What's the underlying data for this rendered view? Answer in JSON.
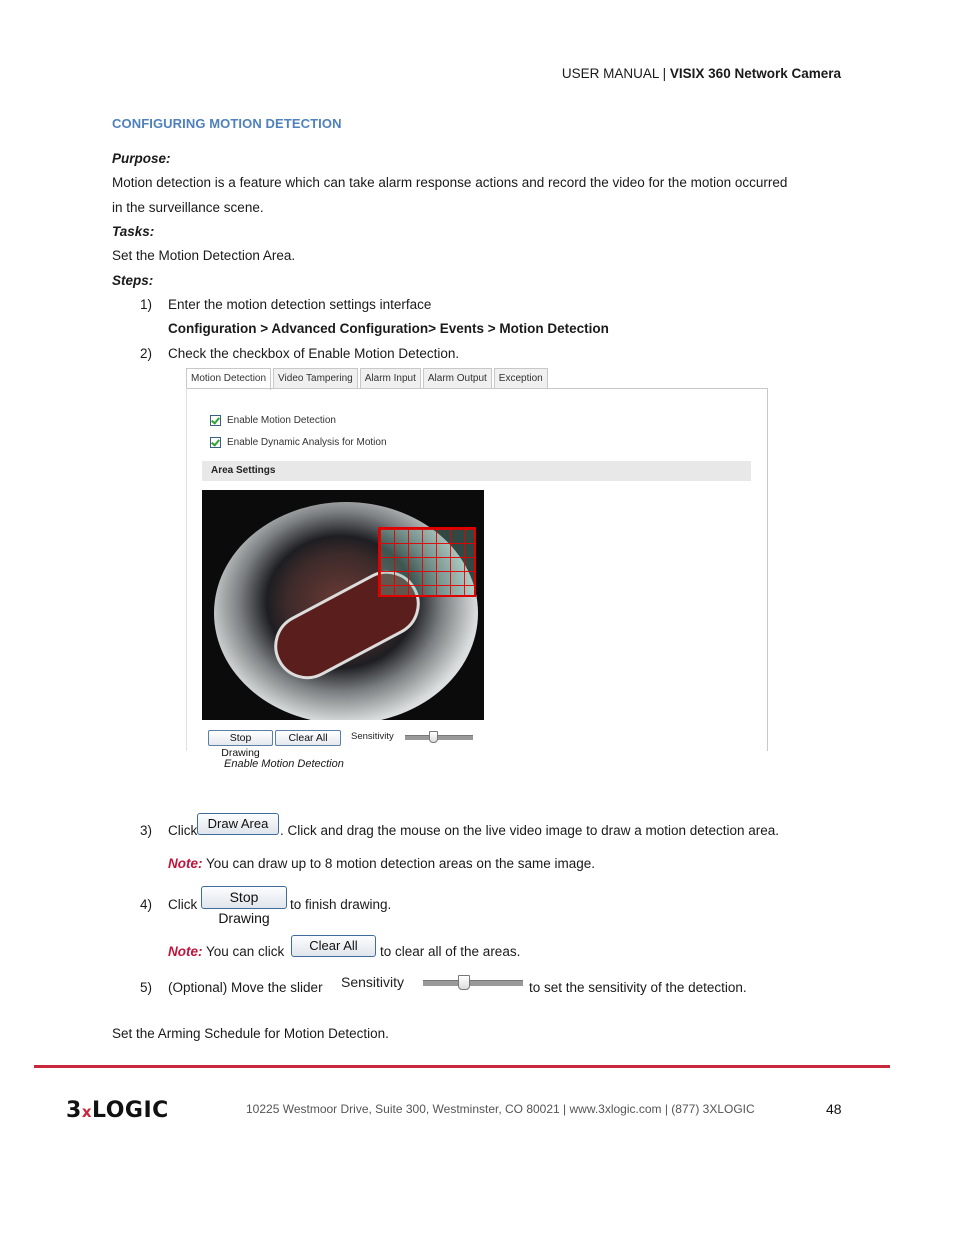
{
  "header": {
    "manual_label": "USER MANUAL",
    "separator": "|",
    "product": "VISIX 360 Network Camera"
  },
  "section_title": "CONFIGURING MOTION DETECTION",
  "purpose": {
    "label": "Purpose:",
    "line1": "Motion detection is a feature which can take alarm response actions and record the video for the motion occurred",
    "line2": "in the surveillance scene."
  },
  "tasks": {
    "label": "Tasks:",
    "text": "Set the Motion Detection Area."
  },
  "steps_label": "Steps:",
  "steps": [
    {
      "num": "1)",
      "text": "Enter the motion detection settings interface",
      "path": "Configuration > Advanced Configuration> Events > Motion Detection"
    },
    {
      "num": "2)",
      "text": "Check the checkbox of Enable Motion Detection."
    },
    {
      "num": "3)",
      "pre": "Click",
      "button": "Draw Area",
      "post": ". Click and drag the mouse on the live video image to draw a motion detection area.",
      "note_label": "Note:",
      "note_text": " You can draw up to 8 motion detection areas on the same image."
    },
    {
      "num": "4)",
      "pre": "Click",
      "button": "Stop Drawing",
      "post": "to finish drawing.",
      "note_label": "Note:",
      "note_pre": " You can click",
      "note_button": "Clear All",
      "note_post": "to clear all of the areas."
    },
    {
      "num": "5)",
      "pre": "(Optional) Move the slider",
      "slider_label": "Sensitivity",
      "slider_value_fraction": 0.4,
      "post": "to set the sensitivity of the detection."
    }
  ],
  "screenshot": {
    "tabs": [
      "Motion Detection",
      "Video Tampering",
      "Alarm Input",
      "Alarm Output",
      "Exception"
    ],
    "active_tab": "Motion Detection",
    "checkboxes": [
      {
        "label": "Enable Motion Detection",
        "checked": true
      },
      {
        "label": "Enable Dynamic Analysis for Motion",
        "checked": true
      }
    ],
    "area_settings_label": "Area Settings",
    "detection_grid": {
      "columns": 7,
      "rows": 5,
      "color": "#e00000"
    },
    "buttons": [
      "Stop Drawing",
      "Clear All"
    ],
    "sensitivity_label": "Sensitivity",
    "sensitivity_fraction": 0.4,
    "caption": "Enable Motion Detection"
  },
  "closing_text": "Set the Arming Schedule for Motion Detection.",
  "footer": {
    "logo_pre": "3",
    "logo_x": "x",
    "logo_post": "LOGIC",
    "address": "10225 Westmoor Drive, Suite 300, Westminster, CO 80021 | www.3xlogic.com | (877) 3XLOGIC",
    "page_number": "48",
    "accent_color": "#c8283c"
  }
}
